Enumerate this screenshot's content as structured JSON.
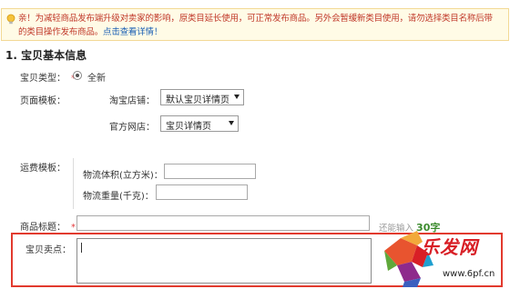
{
  "notice": {
    "line1": "亲！为减轻商品发布端升级对卖家的影响，原类目延长使用，可正常发布商品。另外会暂缓新类目使用，请勿选择类目名称后带",
    "line2": "的类目操作发布商品。",
    "link": "点击查看详情！"
  },
  "section": {
    "title": "1. 宝贝基本信息"
  },
  "form": {
    "item_type_label": "宝贝类型：",
    "item_type_value": "全新",
    "page_template_label": "页面模板：",
    "taobao_store_label": "淘宝店铺：",
    "taobao_store_value": "默认宝贝详情页",
    "official_store_label": "官方网店：",
    "official_store_value": "宝贝详情页",
    "shipping_template_label": "运费模板：",
    "volume_label": "物流体积(立方米)：",
    "weight_label": "物流重量(千克)：",
    "title_label": "商品标题：",
    "title_hint_prefix": "还能输入",
    "title_hint_count": "30字",
    "selling_point_label": "宝贝卖点："
  },
  "required_mark": "*",
  "watermark": {
    "text": "乐发网",
    "url": "www.6pf.cn"
  }
}
